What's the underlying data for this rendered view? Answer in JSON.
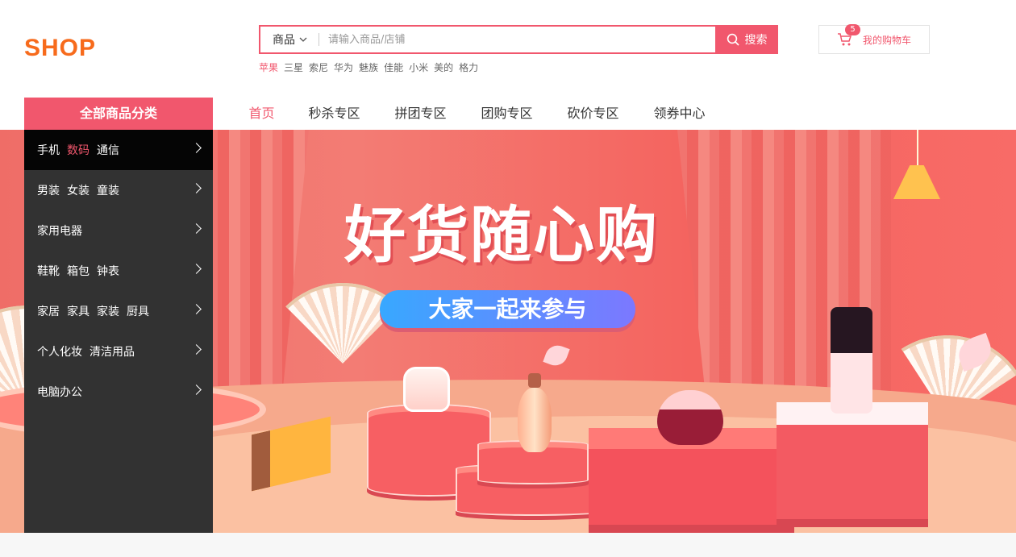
{
  "header": {
    "logo": "SHOP",
    "search": {
      "type_label": "商品",
      "placeholder": "请输入商品/店铺",
      "button_label": "搜索"
    },
    "hotwords": [
      "苹果",
      "三星",
      "索尼",
      "华为",
      "魅族",
      "佳能",
      "小米",
      "美的",
      "格力"
    ],
    "cart": {
      "count": "5",
      "label": "我的购物车"
    }
  },
  "category": {
    "title": "全部商品分类",
    "items": [
      {
        "parts": [
          "手机",
          "数码",
          "通信"
        ]
      },
      {
        "parts": [
          "男装",
          "女装",
          "童装"
        ]
      },
      {
        "parts": [
          "家用电器"
        ]
      },
      {
        "parts": [
          "鞋靴",
          "箱包",
          "钟表"
        ]
      },
      {
        "parts": [
          "家居",
          "家具",
          "家装",
          "厨具"
        ]
      },
      {
        "parts": [
          "个人化妆",
          "清洁用品"
        ]
      },
      {
        "parts": [
          "电脑办公"
        ]
      }
    ]
  },
  "nav": {
    "items": [
      "首页",
      "秒杀专区",
      "拼团专区",
      "团购专区",
      "砍价专区",
      "领券中心"
    ]
  },
  "banner": {
    "headline": "好货随心购",
    "cta": "大家一起来参与"
  },
  "colors": {
    "accent": "#f1576d",
    "logo": "#f76b1c",
    "sidebar": "#323232"
  }
}
